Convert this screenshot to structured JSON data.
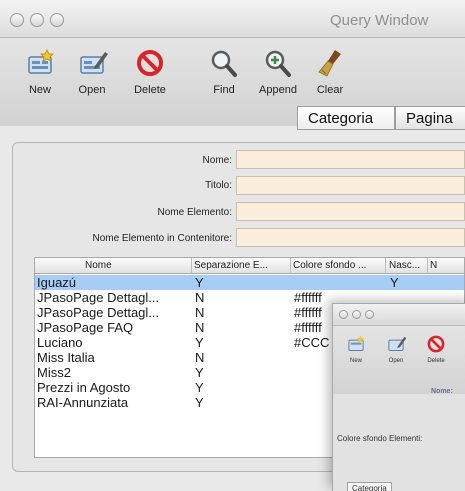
{
  "window": {
    "title": "Query Window"
  },
  "toolbar": {
    "new_label": "New",
    "open_label": "Open",
    "delete_label": "Delete",
    "find_label": "Find",
    "append_label": "Append",
    "clear_label": "Clear"
  },
  "tabs": [
    {
      "label": "Categoria",
      "selected": true
    },
    {
      "label": "Pagina",
      "selected": false
    }
  ],
  "form": {
    "nome_label": "Nome:",
    "titolo_label": "Titolo:",
    "nome_elemento_label": "Nome Elemento:",
    "nome_elemento_contenitore_label": "Nome Elemento in Contenitore:",
    "nome_value": "",
    "titolo_value": "",
    "nome_elemento_value": "",
    "nome_elemento_contenitore_value": ""
  },
  "table": {
    "columns": [
      "Nome",
      "Separazione E...",
      "Colore sfondo ...",
      "Nasc...",
      "N"
    ],
    "rows": [
      {
        "nome": "Iguazú",
        "separazione": "Y",
        "colore": "",
        "nasc": "Y",
        "selected": true
      },
      {
        "nome": "JPasoPage Dettagl...",
        "separazione": "N",
        "colore": "#ffffff",
        "nasc": "",
        "selected": false
      },
      {
        "nome": "JPasoPage Dettagl...",
        "separazione": "N",
        "colore": "#ffffff",
        "nasc": "",
        "selected": false
      },
      {
        "nome": "JPasoPage FAQ",
        "separazione": "N",
        "colore": "#ffffff",
        "nasc": "",
        "selected": false
      },
      {
        "nome": "Luciano",
        "separazione": "Y",
        "colore": "#CCC",
        "nasc": "",
        "selected": false
      },
      {
        "nome": "Miss Italia",
        "separazione": "N",
        "colore": "",
        "nasc": "",
        "selected": false
      },
      {
        "nome": "Miss2",
        "separazione": "Y",
        "colore": "",
        "nasc": "",
        "selected": false
      },
      {
        "nome": "Prezzi in Agosto",
        "separazione": "Y",
        "colore": "",
        "nasc": "",
        "selected": false
      },
      {
        "nome": "RAI-Annunziata",
        "separazione": "Y",
        "colore": "",
        "nasc": "",
        "selected": false
      }
    ]
  },
  "second_window": {
    "toolbar": {
      "new_label": "New",
      "open_label": "Open",
      "delete_label": "Delete"
    },
    "nome_label": "Nome:",
    "colore_label": "Colore sfondo Elementi:",
    "categoria_label": "Categoria"
  },
  "colors": {
    "field_bg": "#fbeedc",
    "selection": "#a8cdf5",
    "delete_red": "#d7262a"
  },
  "icons": [
    "new-record-icon",
    "open-record-icon",
    "delete-icon",
    "find-icon",
    "append-icon",
    "clear-icon"
  ]
}
